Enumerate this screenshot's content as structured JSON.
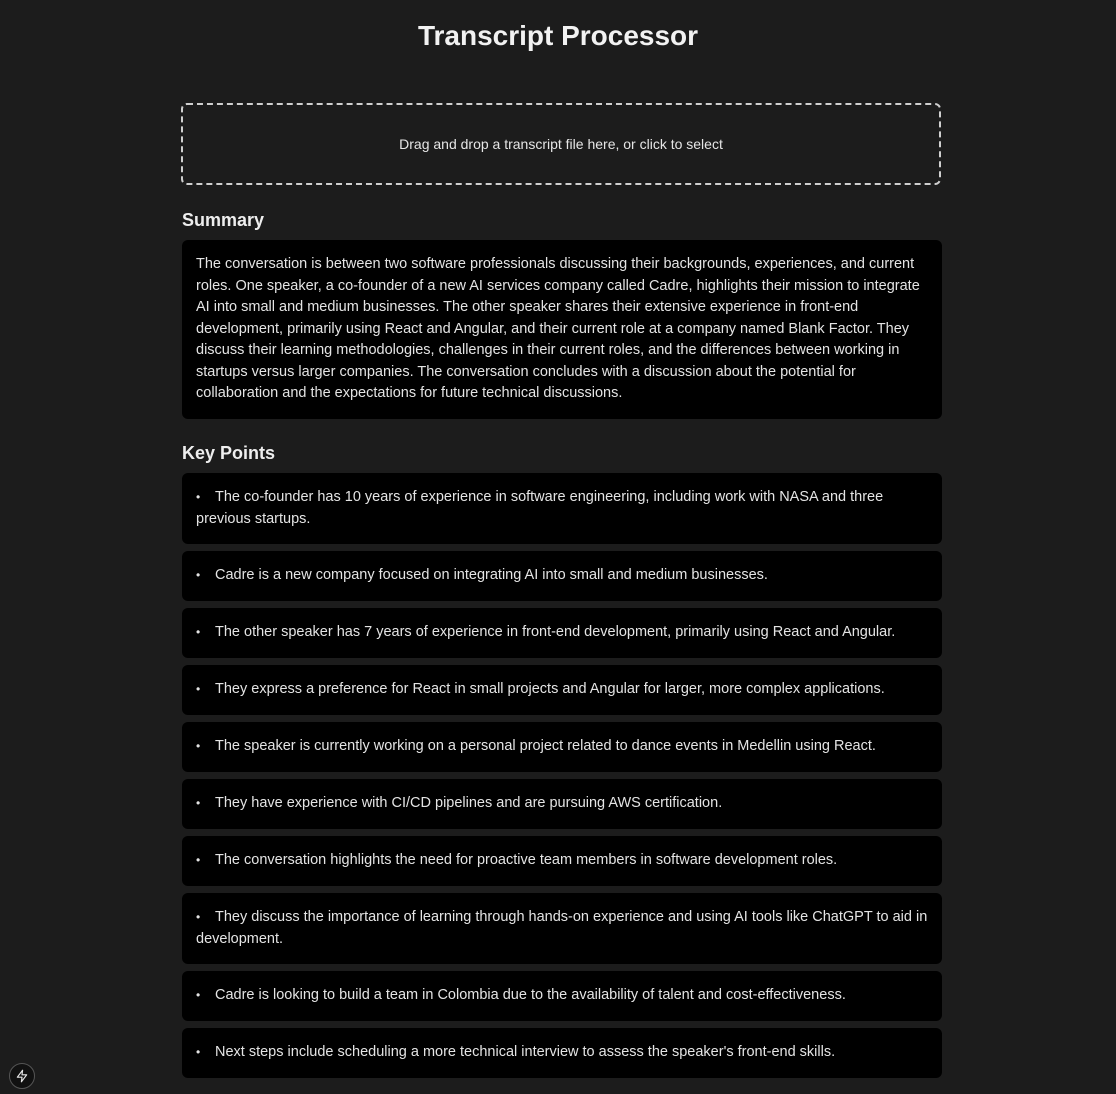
{
  "app": {
    "title": "Transcript Processor"
  },
  "dropzone": {
    "label": "Drag and drop a transcript file here, or click to select"
  },
  "summary": {
    "heading": "Summary",
    "text": "The conversation is between two software professionals discussing their backgrounds, experiences, and current roles. One speaker, a co-founder of a new AI services company called Cadre, highlights their mission to integrate AI into small and medium businesses. The other speaker shares their extensive experience in front-end development, primarily using React and Angular, and their current role at a company named Blank Factor. They discuss their learning methodologies, challenges in their current roles, and the differences between working in startups versus larger companies. The conversation concludes with a discussion about the potential for collaboration and the expectations for future technical discussions."
  },
  "key_points": {
    "heading": "Key Points",
    "bullet": "•",
    "items": [
      "The co-founder has 10 years of experience in software engineering, including work with NASA and three previous startups.",
      "Cadre is a new company focused on integrating AI into small and medium businesses.",
      "The other speaker has 7 years of experience in front-end development, primarily using React and Angular.",
      "They express a preference for React in small projects and Angular for larger, more complex applications.",
      "The speaker is currently working on a personal project related to dance events in Medellin using React.",
      "They have experience with CI/CD pipelines and are pursuing AWS certification.",
      "The conversation highlights the need for proactive team members in software development roles.",
      "They discuss the importance of learning through hands-on experience and using AI tools like ChatGPT to aid in development.",
      "Cadre is looking to build a team in Colombia due to the availability of talent and cost-effectiveness.",
      "Next steps include scheduling a more technical interview to assess the speaker's front-end skills."
    ]
  },
  "corner_button": {
    "icon": "lightning-bolt-icon"
  },
  "colors": {
    "background": "#1c1c1c",
    "card": "#000000",
    "text": "#e4e4e4"
  }
}
